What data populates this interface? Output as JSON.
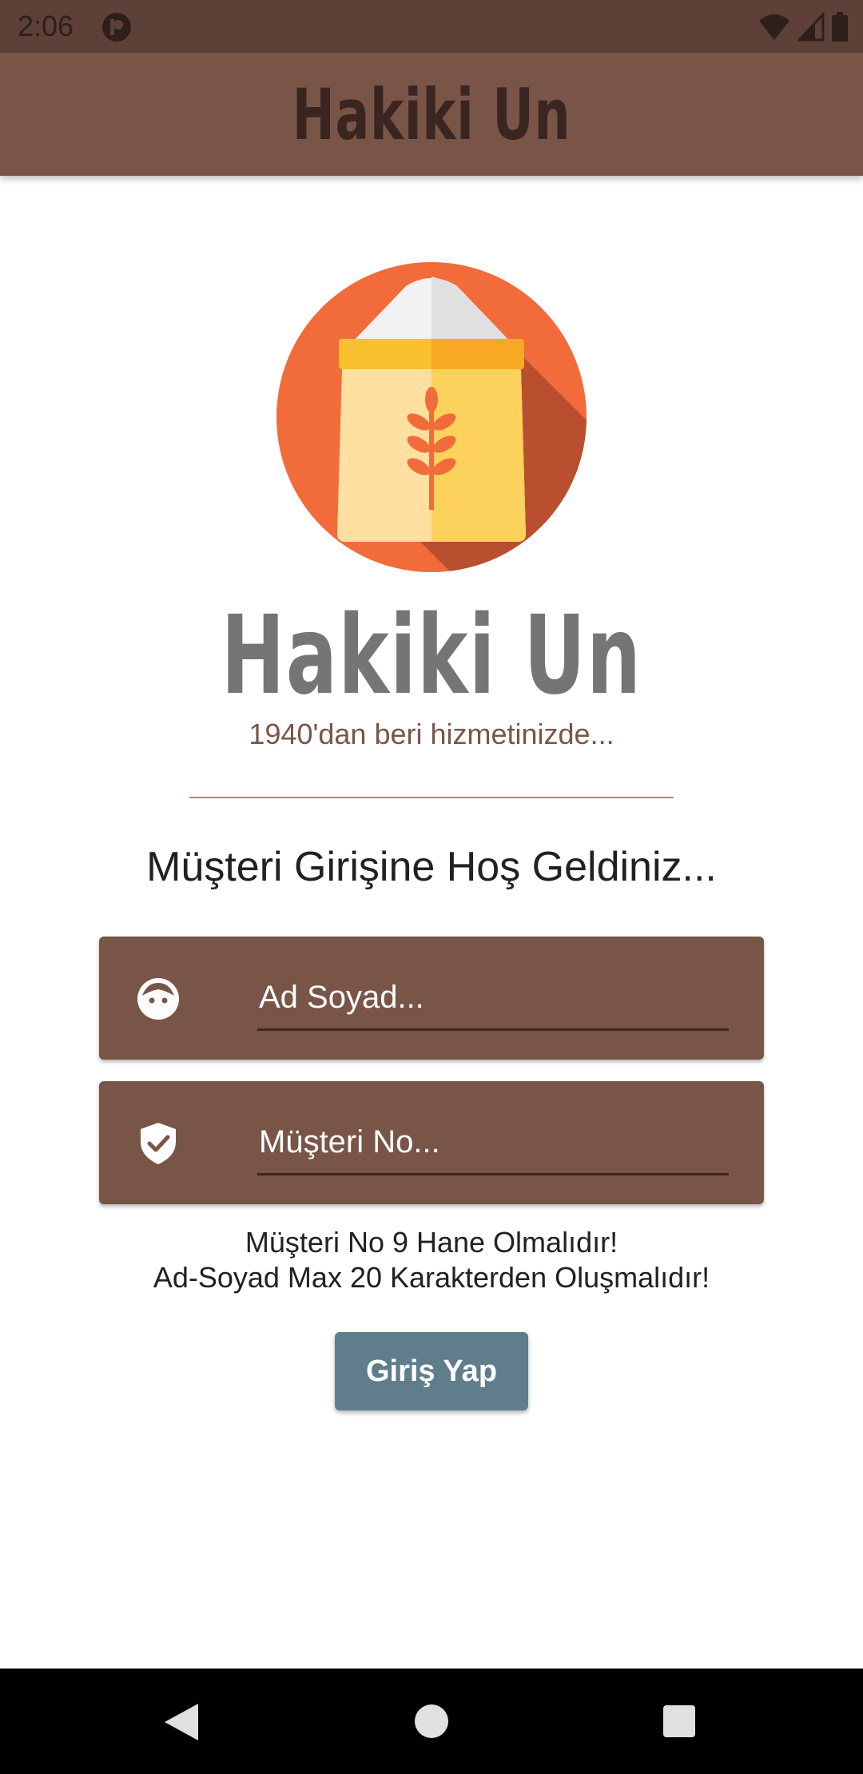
{
  "status_bar": {
    "time": "2:06",
    "icons": [
      "app-notification-icon",
      "wifi-icon",
      "cell-signal-icon",
      "battery-icon"
    ]
  },
  "app_bar": {
    "title": "Hakiki Un"
  },
  "brand": {
    "logo_icon": "flour-sack-icon",
    "title": "Hakiki Un",
    "subtitle": "1940'dan beri hizmetinizde..."
  },
  "welcome": "Müşteri Girişine Hoş Geldiniz...",
  "form": {
    "name_field": {
      "placeholder": "Ad Soyad...",
      "value": "",
      "icon": "face-icon"
    },
    "customer_no_field": {
      "placeholder": "Müşteri No...",
      "value": "",
      "icon": "verified-shield-icon"
    },
    "rules": [
      "Müşteri No 9 Hane Olmalıdır!",
      "Ad-Soyad Max 20 Karakterden Oluşmalıdır!"
    ],
    "submit_label": "Giriş Yap"
  },
  "nav_bar": {
    "icons": [
      "back-icon",
      "home-icon",
      "recents-icon"
    ]
  },
  "colors": {
    "status_bar": "#5d4037",
    "app_bar": "#795548",
    "primary": "#795548",
    "button": "#607d8b",
    "brand_text": "#757575"
  }
}
